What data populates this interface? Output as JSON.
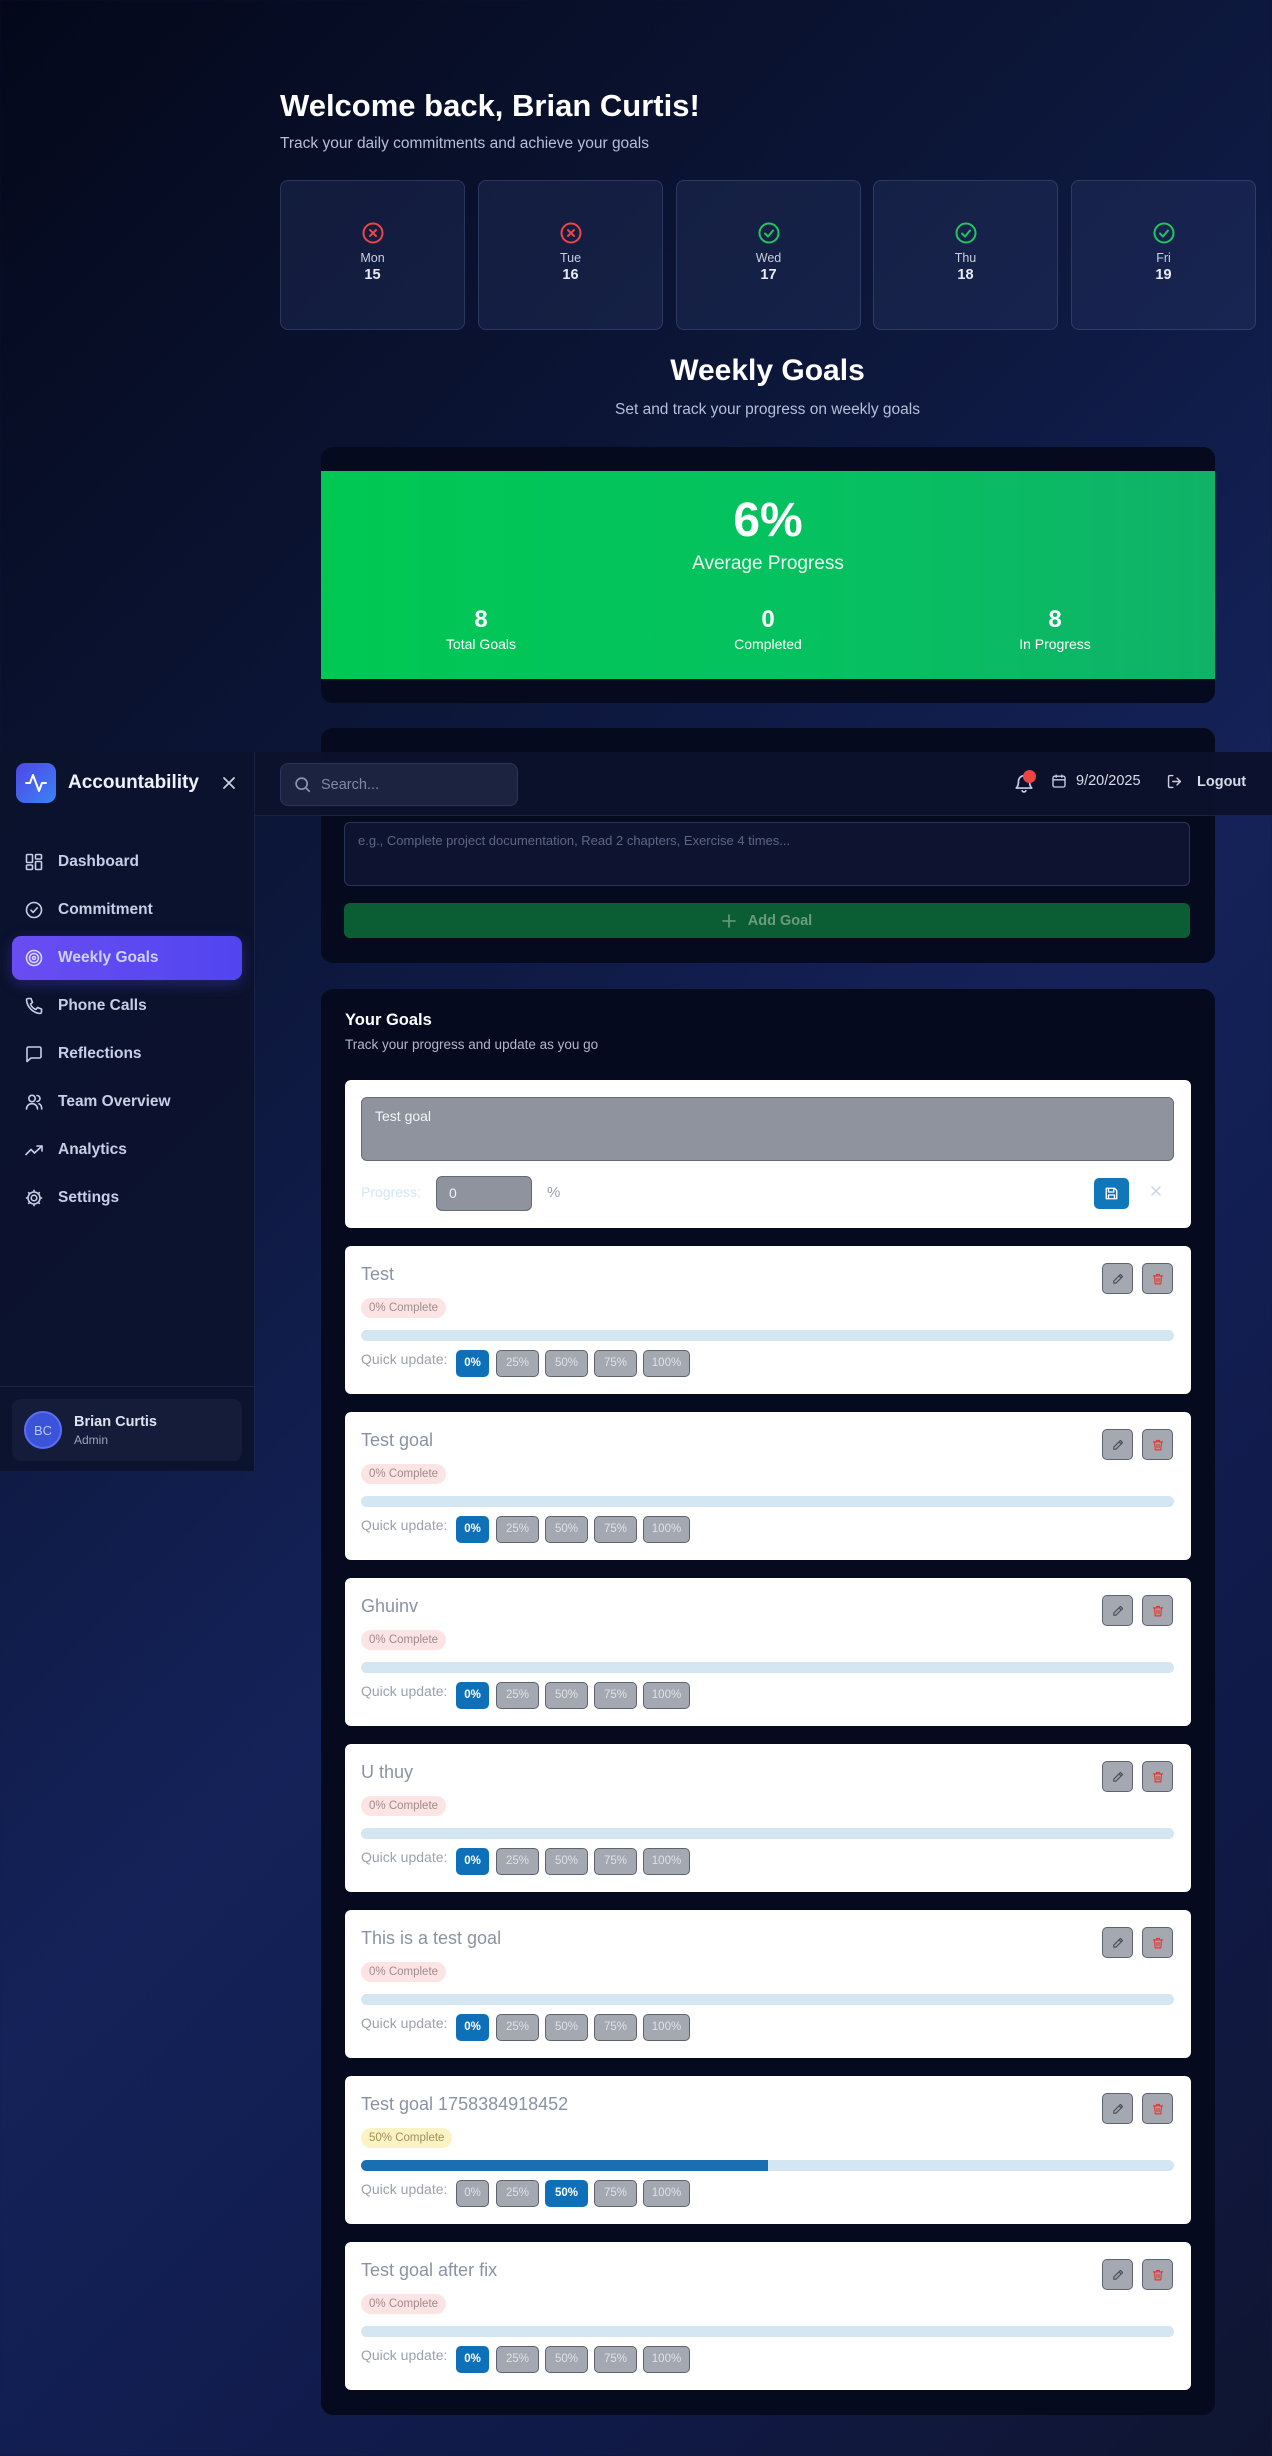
{
  "header": {
    "welcome": "Welcome back, Brian Curtis!",
    "subtitle": "Track your daily commitments and achieve your goals"
  },
  "days": [
    {
      "name": "Mon",
      "date": "15",
      "status": "missed",
      "icon": "x-circle-icon",
      "color": "#ef4444"
    },
    {
      "name": "Tue",
      "date": "16",
      "status": "missed",
      "icon": "x-circle-icon",
      "color": "#ef4444"
    },
    {
      "name": "Wed",
      "date": "17",
      "status": "done",
      "icon": "check-circle-icon",
      "color": "#22c55e"
    },
    {
      "name": "Thu",
      "date": "18",
      "status": "done",
      "icon": "check-circle-icon",
      "color": "#22c55e"
    },
    {
      "name": "Fri",
      "date": "19",
      "status": "done",
      "icon": "check-circle-icon",
      "color": "#22c55e"
    }
  ],
  "weekly_goals": {
    "title": "Weekly Goals",
    "subtitle": "Set and track your progress on weekly goals",
    "average_progress": "6%",
    "average_label": "Average Progress",
    "stats": [
      {
        "value": "8",
        "label": "Total Goals"
      },
      {
        "value": "0",
        "label": "Completed"
      },
      {
        "value": "8",
        "label": "In Progress"
      }
    ]
  },
  "add_goal": {
    "placeholder": "e.g., Complete project documentation, Read 2 chapters, Exercise 4 times...",
    "button_label": "Add Goal"
  },
  "topbar": {
    "search_placeholder": "Search...",
    "date": "9/20/2025",
    "logout_label": "Logout"
  },
  "sidebar": {
    "brand": "Accountability",
    "items": [
      {
        "label": "Dashboard",
        "icon": "grid-icon",
        "active": false
      },
      {
        "label": "Commitment",
        "icon": "check-circle-icon",
        "active": false
      },
      {
        "label": "Weekly Goals",
        "icon": "target-icon",
        "active": true
      },
      {
        "label": "Phone Calls",
        "icon": "phone-icon",
        "active": false
      },
      {
        "label": "Reflections",
        "icon": "message-icon",
        "active": false
      },
      {
        "label": "Team Overview",
        "icon": "users-icon",
        "active": false
      },
      {
        "label": "Analytics",
        "icon": "trending-up-icon",
        "active": false
      },
      {
        "label": "Settings",
        "icon": "gear-icon",
        "active": false
      }
    ],
    "user": {
      "initials": "BC",
      "name": "Brian Curtis",
      "role": "Admin"
    }
  },
  "goals": {
    "title": "Your Goals",
    "subtitle": "Track your progress and update as you go",
    "editing": {
      "value": "Test goal",
      "progress_label": "Progress:",
      "progress_value": "0",
      "percent_sign": "%"
    },
    "quick_update_label": "Quick update:",
    "quick_options": [
      "0%",
      "25%",
      "50%",
      "75%",
      "100%"
    ],
    "list": [
      {
        "name": "Test",
        "badge": "0% Complete",
        "progress": 0
      },
      {
        "name": "Test goal",
        "badge": "0% Complete",
        "progress": 0
      },
      {
        "name": "Ghuinv",
        "badge": "0% Complete",
        "progress": 0
      },
      {
        "name": "U thuy",
        "badge": "0% Complete",
        "progress": 0
      },
      {
        "name": "This is a test goal",
        "badge": "0% Complete",
        "progress": 0
      },
      {
        "name": "Test goal 1758384918452",
        "badge": "50% Complete",
        "progress": 50
      },
      {
        "name": "Test goal after fix",
        "badge": "0% Complete",
        "progress": 0
      }
    ]
  },
  "colors": {
    "accent": "#5145ef",
    "success": "#00c853",
    "progress_blue": "#1a6fb0",
    "danger": "#ef4444"
  }
}
